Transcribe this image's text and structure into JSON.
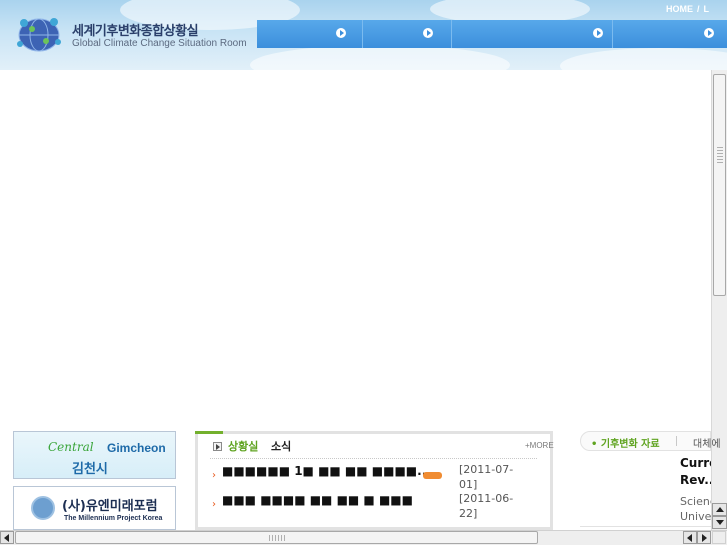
{
  "header": {
    "site_title_ko": "세계기후변화종합상황실",
    "site_title_en": "Global Climate Change Situation Room",
    "top_links": [
      "HOME",
      "L"
    ],
    "nav_items": [
      {
        "icon": "arrow-circle-icon"
      },
      {
        "icon": "arrow-circle-icon"
      },
      {
        "icon": "arrow-circle-icon"
      },
      {
        "icon": "arrow-circle-icon"
      }
    ]
  },
  "banners": {
    "gimcheon": {
      "brand": "Central",
      "brand2": "Gimcheon",
      "city": "김천시"
    },
    "millennium": {
      "name": "(사)유엔미래포럼",
      "sub": "The Millennium Project Korea"
    }
  },
  "news": {
    "title_green": "상황실",
    "title_dark": "소식",
    "more_label": "+MORE",
    "items": [
      {
        "text": "■■■■■■ 1■ ■■ ■■ ■■■■...",
        "date": "[2011-07-01]",
        "is_new": true
      },
      {
        "text": "■■■ ■■■■ ■■ ■■ ■ ■■■",
        "date": "[2011-06-22]",
        "is_new": false
      }
    ]
  },
  "resources": {
    "tab_active": "• 기후변화 자료",
    "tab_other": "대체에",
    "title_lines": [
      "Curre",
      "Rev..."
    ],
    "sub_lines": [
      "Scienc",
      "Univer"
    ]
  },
  "colors": {
    "nav_blue": "#3c8fdc",
    "accent_green": "#5fa320",
    "bullet_orange": "#e8581c",
    "new_badge": "#f08c32"
  }
}
